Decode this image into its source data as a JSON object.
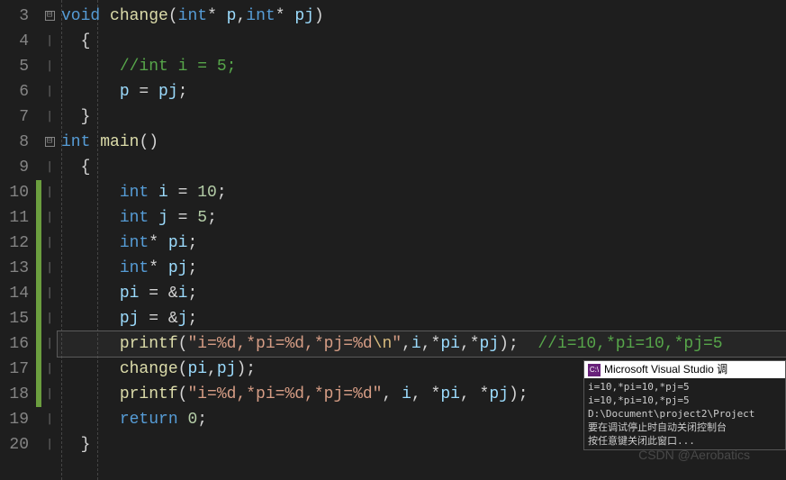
{
  "gutter": {
    "start": 3,
    "end": 20
  },
  "fold": {
    "line3": "⊟",
    "line8": "⊟"
  },
  "code": {
    "l3": {
      "kw1": "void",
      "fn": "change",
      "p": "(",
      "kw2": "int",
      "star1": "* ",
      "a1": "p",
      "comma": ",",
      "kw3": "int",
      "star2": "* ",
      "a2": "pj",
      "cp": ")"
    },
    "l4": {
      "brace": "{"
    },
    "l5": {
      "comment": "//int i = 5;"
    },
    "l6": {
      "v1": "p",
      "eq": " = ",
      "v2": "pj",
      "semi": ";"
    },
    "l7": {
      "brace": "}"
    },
    "l8": {
      "kw1": "int",
      "fn": "main",
      "p": "()"
    },
    "l9": {
      "brace": "{"
    },
    "l10": {
      "kw": "int",
      "v": "i",
      "eq": " = ",
      "n": "10",
      "semi": ";"
    },
    "l11": {
      "kw": "int",
      "v": "j",
      "eq": " = ",
      "n": "5",
      "semi": ";"
    },
    "l12": {
      "kw": "int",
      "star": "* ",
      "v": "pi",
      "semi": ";"
    },
    "l13": {
      "kw": "int",
      "star": "* ",
      "v": "pj",
      "semi": ";"
    },
    "l14": {
      "v1": "pi",
      "eq": " = &",
      "v2": "i",
      "semi": ";"
    },
    "l15": {
      "v1": "pj",
      "eq": " = &",
      "v2": "j",
      "semi": ";"
    },
    "l16": {
      "fn": "printf",
      "p": "(",
      "s1": "\"i=%d,*pi=%d,*pj=%d",
      "esc": "\\n",
      "s2": "\"",
      "c1": ",",
      "a1": "i",
      "c2": ",*",
      "a2": "pi",
      "c3": ",*",
      "a3": "pj",
      "cp": ");",
      "cm": "//i=10,*pi=10,*pj=5"
    },
    "l17": {
      "fn": "change",
      "p": "(",
      "a1": "pi",
      "c": ",",
      "a2": "pj",
      "cp": ");"
    },
    "l18": {
      "fn": "printf",
      "p": "(",
      "s": "\"i=%d,*pi=%d,*pj=%d\"",
      "c1": ", ",
      "a1": "i",
      "c2": ", *",
      "a2": "pi",
      "c3": ", *",
      "a3": "pj",
      "cp": ");"
    },
    "l19": {
      "kw": "return",
      "n": "0",
      "semi": ";"
    },
    "l20": {
      "brace": "}"
    }
  },
  "tooltip": {
    "icon": "C:\\",
    "title": "Microsoft Visual Studio 调",
    "body": "i=10,*pi=10,*pj=5\ni=10,*pi=10,*pj=5\nD:\\Document\\project2\\Project\n要在调试停止时自动关闭控制台\n按任意键关闭此窗口..."
  },
  "watermark": "CSDN @Aerobatics"
}
